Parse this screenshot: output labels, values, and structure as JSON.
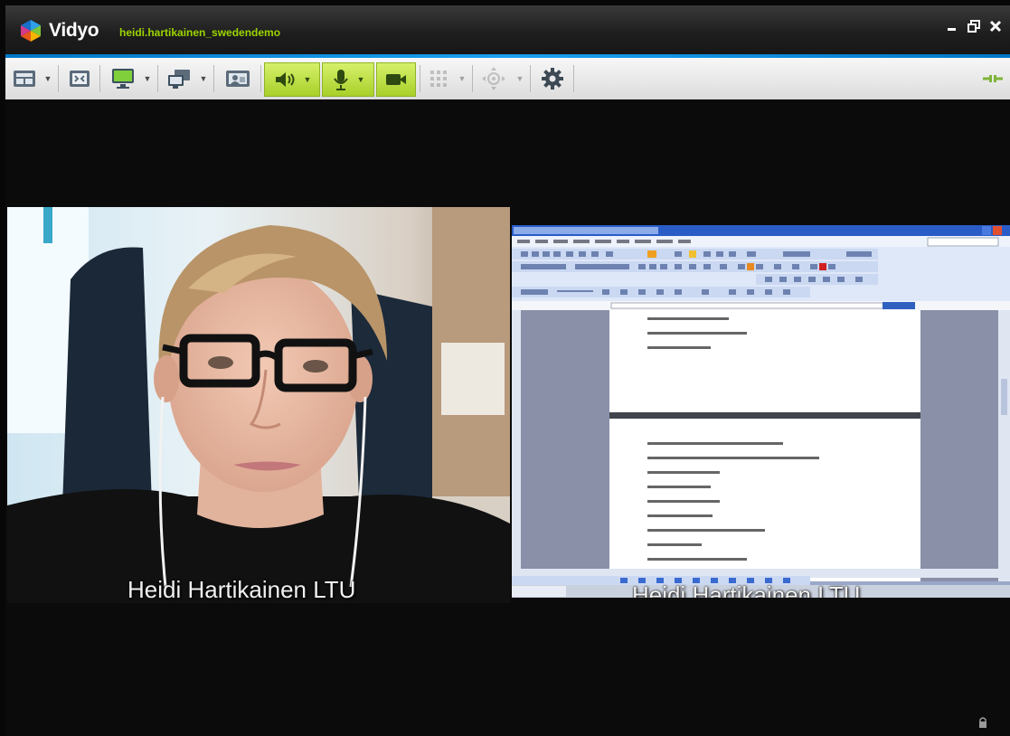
{
  "app": {
    "brand": "Vidyo",
    "username": "heidi.hartikainen_swedendemo"
  },
  "window_controls": [
    "minimize-icon",
    "restore-icon",
    "close-icon"
  ],
  "toolbar": {
    "buttons": [
      "layout-icon",
      "fullscreen-icon",
      "monitor-icon",
      "windows-icon",
      "self-view-icon",
      "speaker-icon",
      "microphone-icon",
      "camera-icon",
      "dialpad-icon",
      "camera-control-icon",
      "settings-icon"
    ],
    "right_icon": "network-icon"
  },
  "colors": {
    "accent_blue": "#1aa0f0",
    "username_green": "#9cd400",
    "active_button": "#b8dc3a",
    "background": "#0b0b0b"
  },
  "participants": [
    {
      "kind": "camera",
      "caption": "Heidi Hartikainen LTU"
    },
    {
      "kind": "screen-share",
      "caption": "Heidi Hartikainen LTU"
    }
  ],
  "status_icon": "lock-icon"
}
